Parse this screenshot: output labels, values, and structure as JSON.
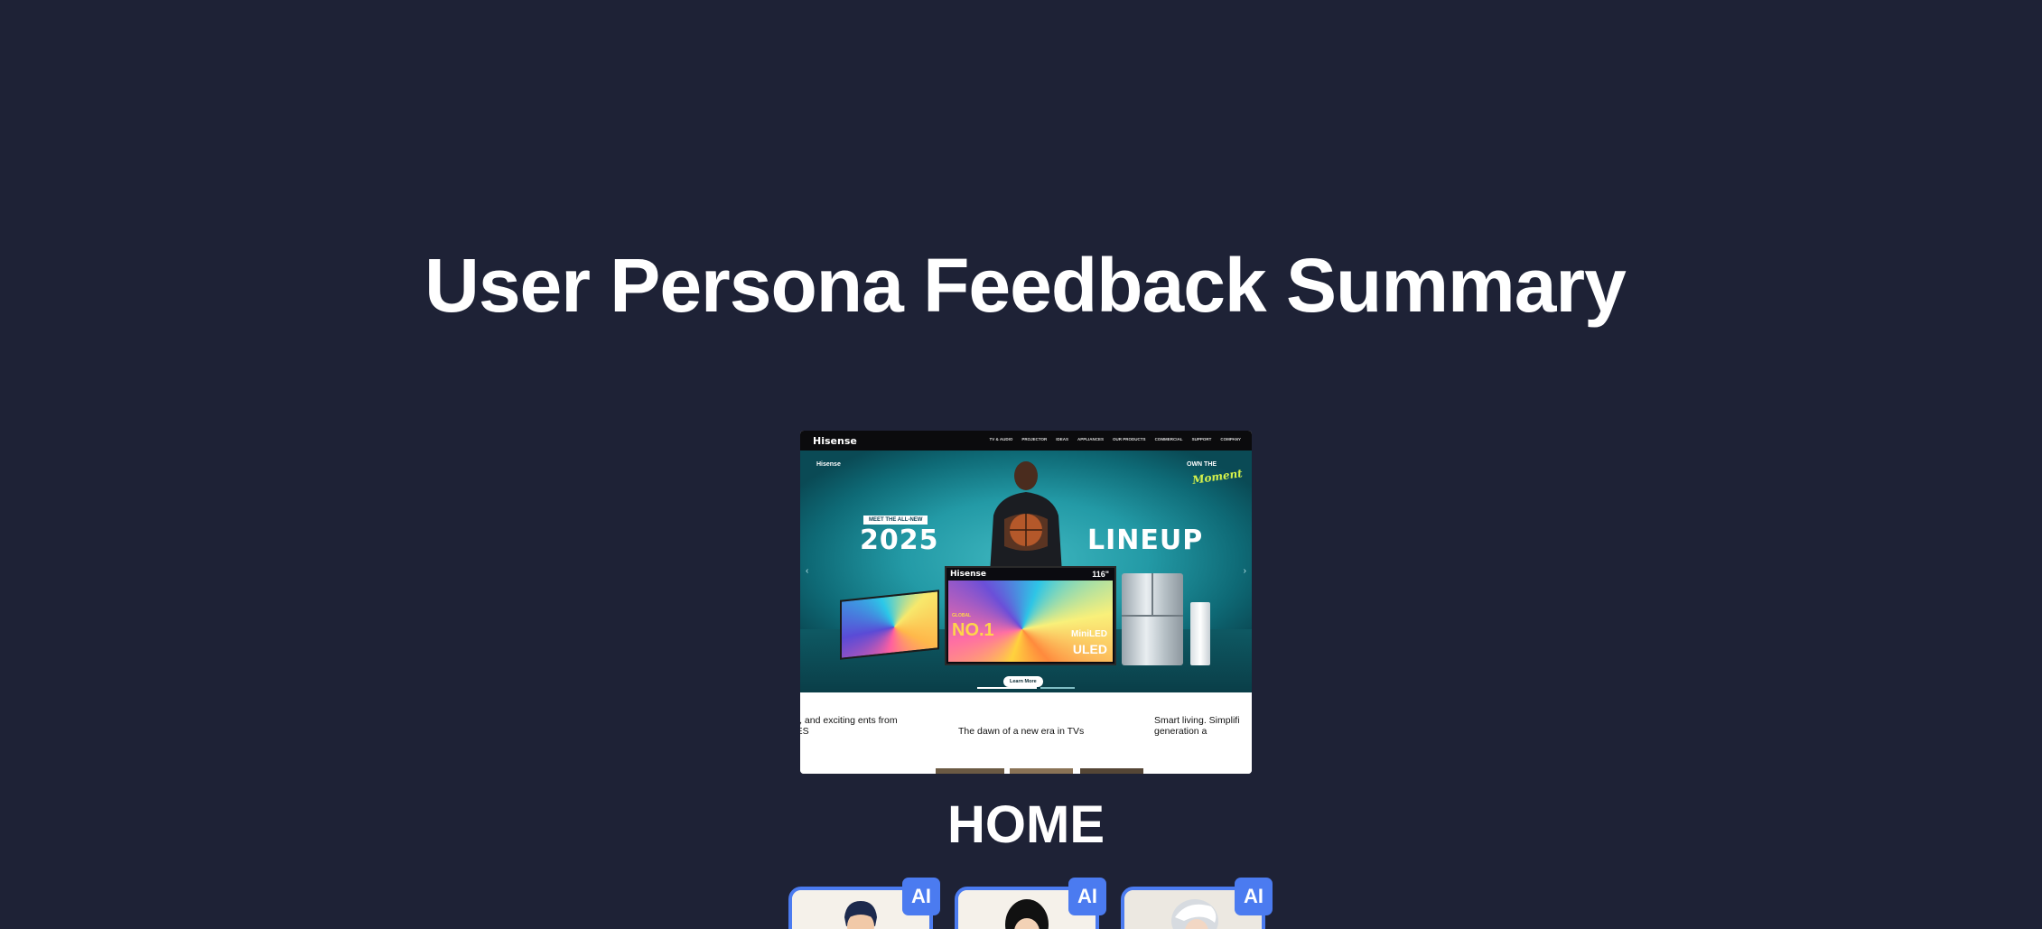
{
  "page": {
    "title": "User Persona Feedback Summary",
    "section_label": "HOME"
  },
  "screenshot": {
    "nav": {
      "logo": "Hisense",
      "links": [
        "TV & Audio",
        "Projector",
        "Ideas",
        "Appliances",
        "Our Products",
        "Commercial",
        "Support",
        "Company"
      ]
    },
    "hero": {
      "brand_corner": "Hisense",
      "moment_own": "OWN THE",
      "moment_word": "Moment",
      "meet": "MEET THE ALL-NEW",
      "year": "2025",
      "lineup": "LINEUP",
      "tv_brand": "Hisense",
      "tv_size": "116\"",
      "tv_global": "GLOBAL",
      "tv_no1": "NO.1",
      "tv_miniled": "MiniLED",
      "tv_uled": "ULED",
      "learn_more": "Learn More"
    },
    "cards": [
      "ds, and exciting ents from CES",
      "The dawn of a new era in TVs",
      "Smart living. Simplifi generation a"
    ]
  },
  "personas": [
    {
      "badge": "AI"
    },
    {
      "badge": "AI"
    },
    {
      "badge": "AI"
    }
  ],
  "colors": {
    "background": "#1e2236",
    "accent": "#4b7bf0"
  }
}
